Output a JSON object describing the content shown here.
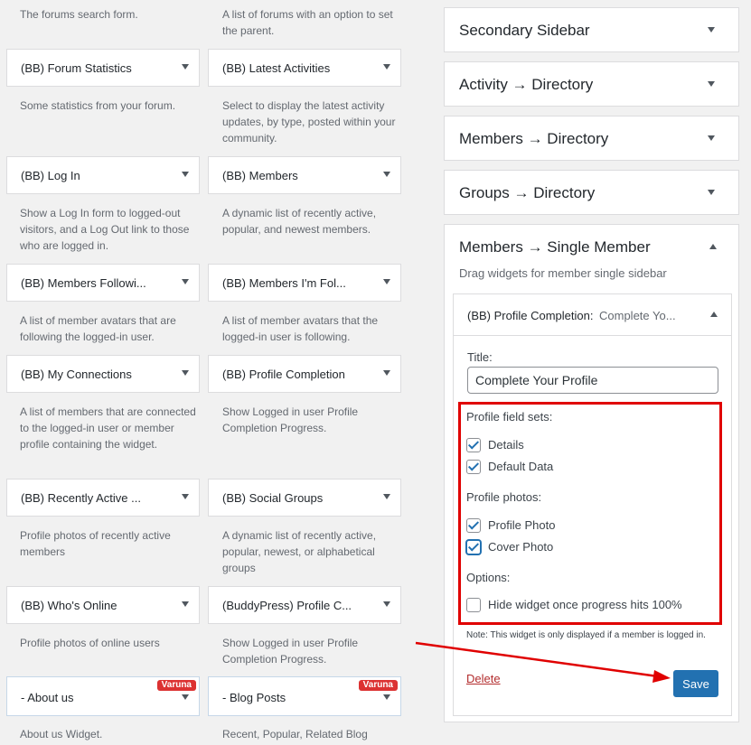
{
  "available_widgets": [
    {
      "desc": "The forums search form."
    },
    {
      "desc": "A list of forums with an option to set the parent."
    },
    {
      "title": "(BB) Forum Statistics",
      "desc": "Some statistics from your forum."
    },
    {
      "title": "(BB) Latest Activities",
      "desc": "Select to display the latest activity updates, by type, posted within your community."
    },
    {
      "title": "(BB) Log In",
      "desc": "Show a Log In form to logged-out visitors, and a Log Out link to those who are logged in."
    },
    {
      "title": "(BB) Members",
      "desc": "A dynamic list of recently active, popular, and newest members."
    },
    {
      "title": "(BB) Members Followi...",
      "desc": "A list of member avatars that are following the logged-in user."
    },
    {
      "title": "(BB) Members I'm Fol...",
      "desc": "A list of member avatars that the logged-in user is following."
    },
    {
      "title": "(BB) My Connections",
      "desc": "A list of members that are connected to the logged-in user or member profile containing the widget."
    },
    {
      "title": "(BB) Profile Completion",
      "desc": "Show Logged in user Profile Completion Progress."
    },
    {
      "title": "(BB) Recently Active ...",
      "desc": "Profile photos of recently active members"
    },
    {
      "title": "(BB) Social Groups",
      "desc": "A dynamic list of recently active, popular, newest, or alphabetical groups"
    },
    {
      "title": "(BB) Who's Online",
      "desc": "Profile photos of online users"
    },
    {
      "title": "(BuddyPress) Profile C...",
      "desc": "Show Logged in user Profile Completion Progress."
    },
    {
      "title": "- About us",
      "badge": "Varuna",
      "desc": "About us Widget."
    },
    {
      "title": "- Blog Posts",
      "badge": "Varuna",
      "desc": "Recent, Popular, Related Blog"
    }
  ],
  "sidebars": [
    {
      "title": "Secondary Sidebar"
    },
    {
      "title": "Activity → Directory"
    },
    {
      "title": "Members → Directory"
    },
    {
      "title": "Groups → Directory"
    }
  ],
  "open_sidebar": {
    "title": "Members → Single Member",
    "description": "Drag widgets for member single sidebar",
    "widget": {
      "header_title": "(BB) Profile Completion:",
      "header_subtitle": "Complete Yo...",
      "title_label": "Title:",
      "title_value": "Complete Your Profile",
      "field_sets_label": "Profile field sets:",
      "field_sets": [
        {
          "label": "Details",
          "checked": true
        },
        {
          "label": "Default Data",
          "checked": true
        }
      ],
      "photos_label": "Profile photos:",
      "photos": [
        {
          "label": "Profile Photo",
          "checked": true
        },
        {
          "label": "Cover Photo",
          "checked": true
        }
      ],
      "options_label": "Options:",
      "options": [
        {
          "label": "Hide widget once progress hits 100%",
          "checked": false
        }
      ],
      "note": "Note: This widget is only displayed if a member is logged in.",
      "delete_label": "Delete",
      "save_label": "Save"
    }
  },
  "colors": {
    "highlight_box": "#e00000",
    "annotation_arrow": "#e00000",
    "save_button": "#2271b1",
    "badge": "#dc3232"
  }
}
